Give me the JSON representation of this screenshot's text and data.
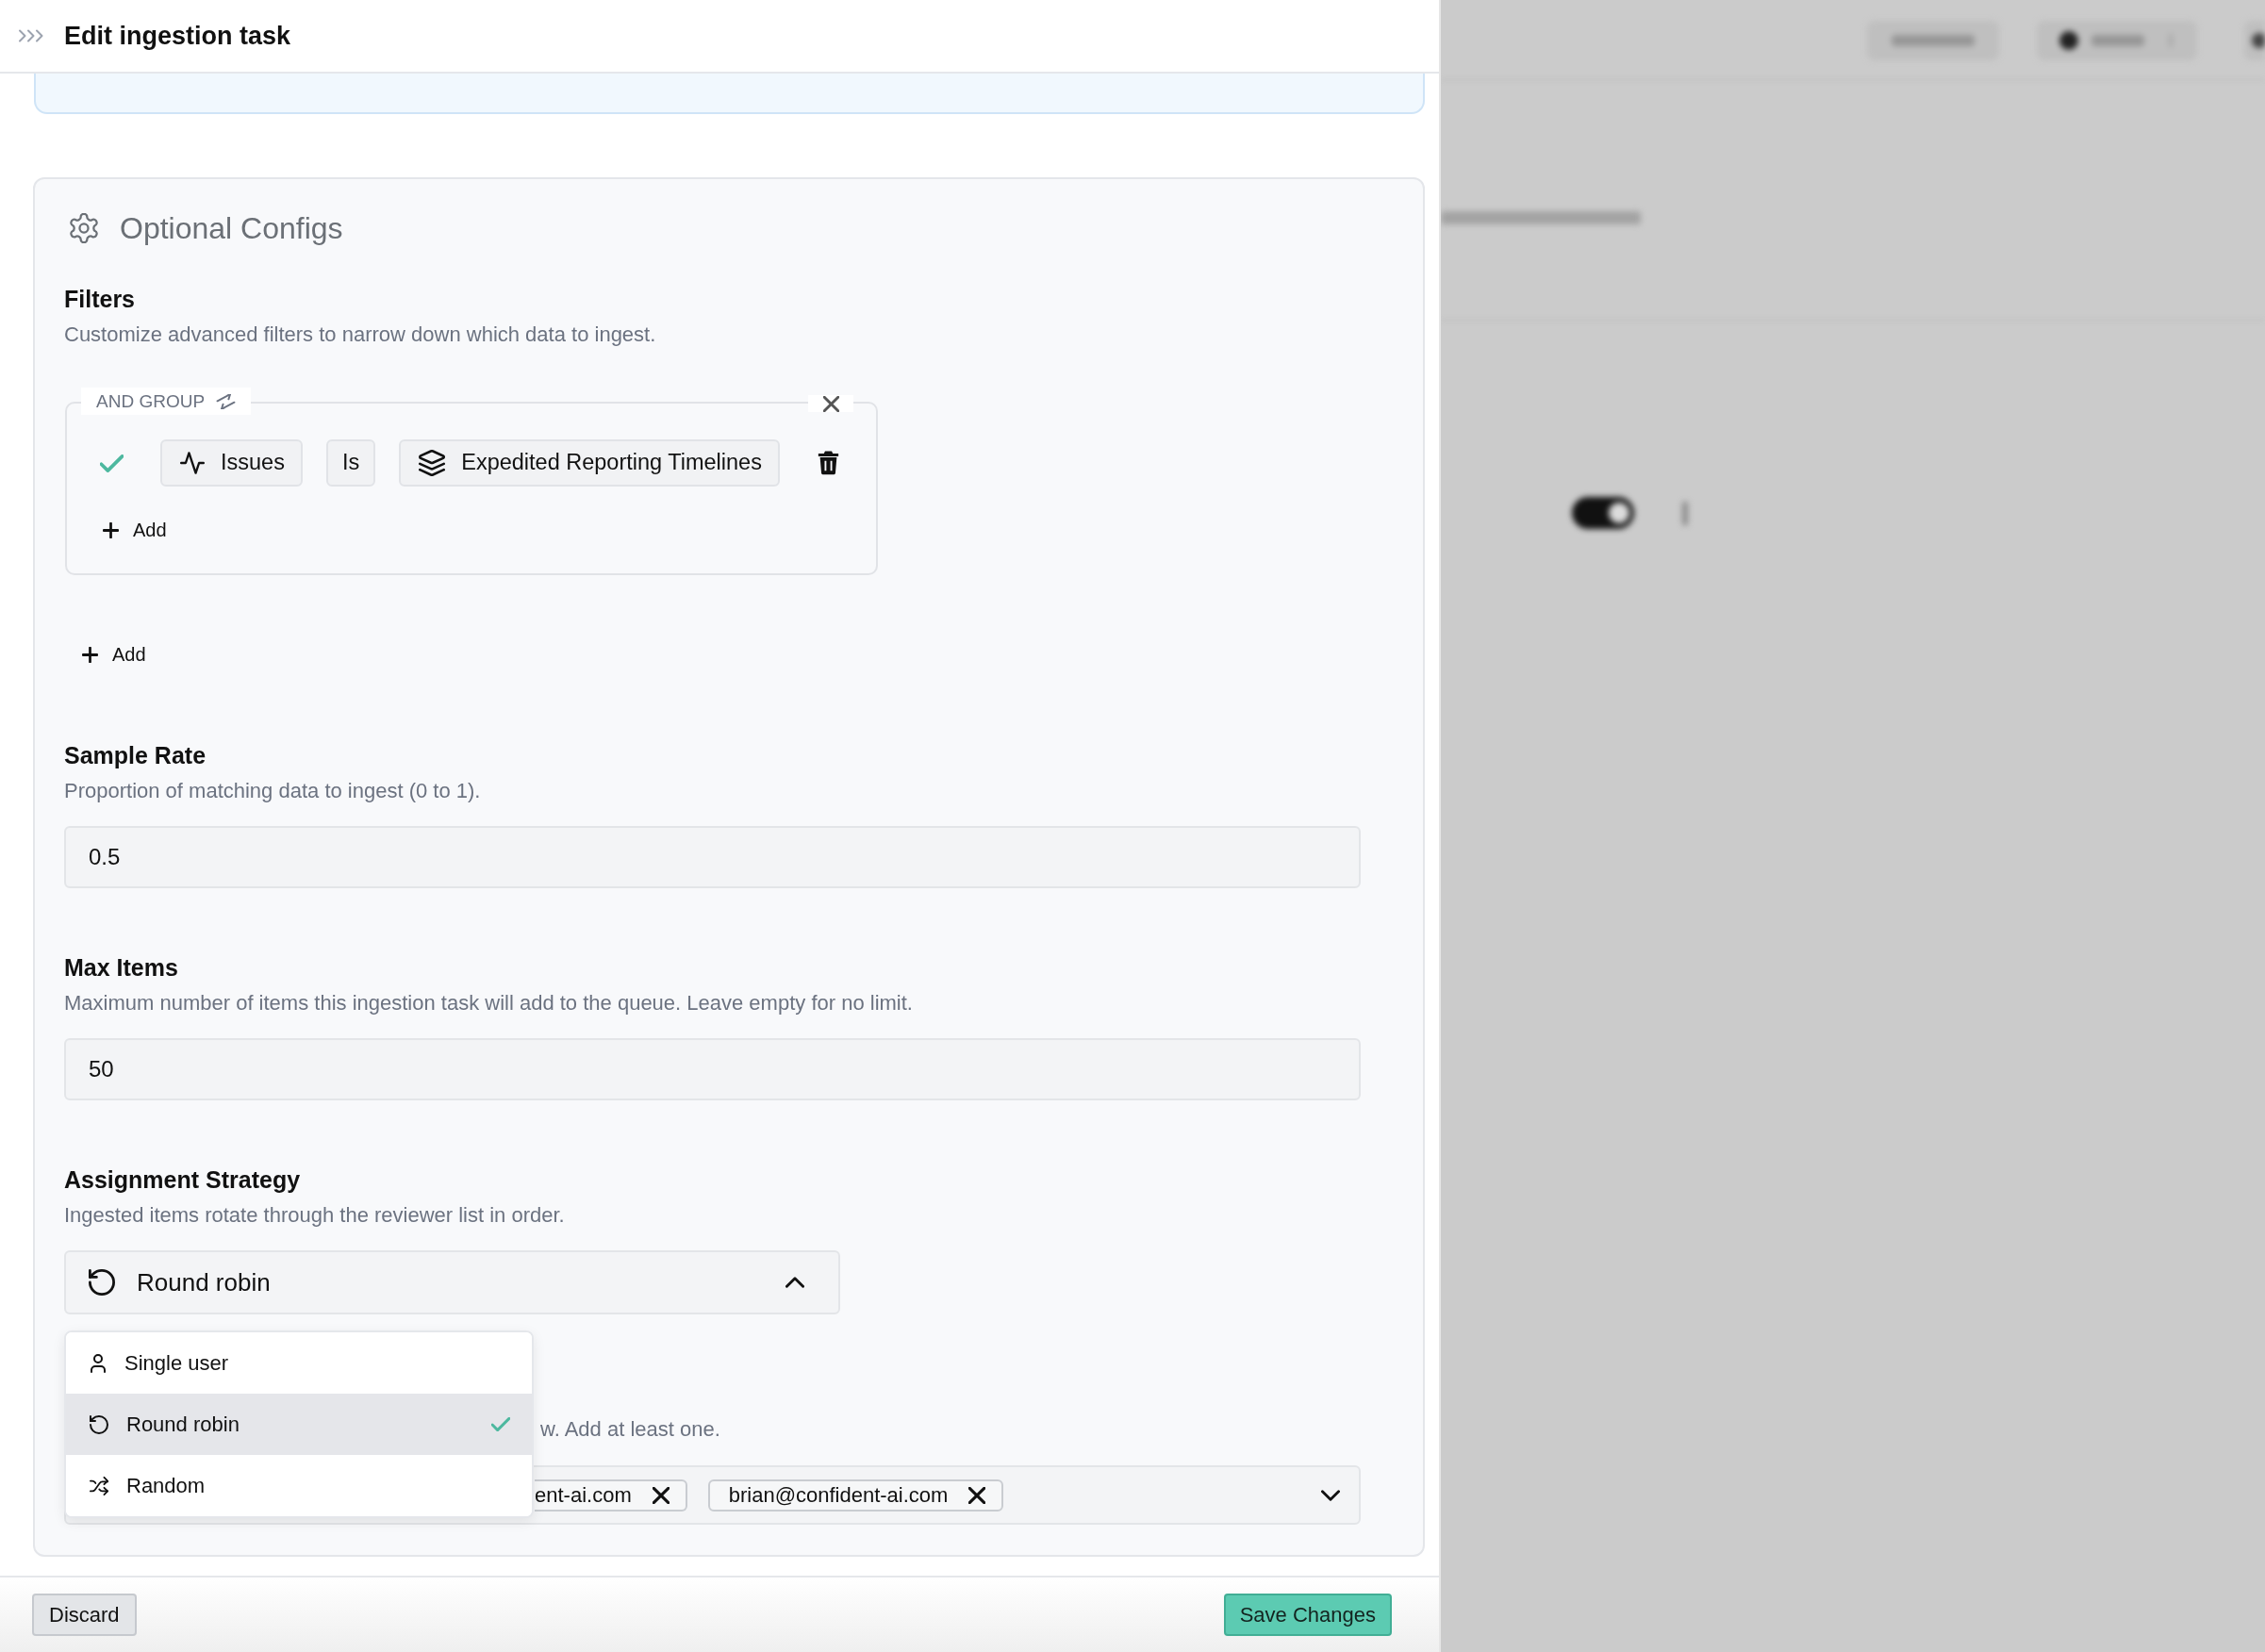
{
  "drawer": {
    "title": "Edit ingestion task"
  },
  "optional_configs": {
    "title": "Optional Configs",
    "filters": {
      "label": "Filters",
      "description": "Customize advanced filters to narrow down which data to ingest.",
      "groups": [
        {
          "operator": "AND GROUP",
          "conditions": [
            {
              "valid": true,
              "field": "Issues",
              "operator": "Is",
              "value": "Expedited Reporting Timelines"
            }
          ],
          "add_label": "Add"
        }
      ],
      "add_label": "Add"
    },
    "fields": [
      {
        "label": "Sample Rate",
        "description": "Proportion of matching data to ingest (0 to 1).",
        "value": "0.5"
      },
      {
        "label": "Max Items",
        "description": "Maximum number of items this ingestion task will add to the queue. Leave empty for no limit.",
        "value": "50"
      }
    ],
    "assignment_strategy": {
      "label": "Assignment Strategy",
      "description": "Ingested items rotate through the reviewer list in order.",
      "value": "Round robin",
      "expanded": true,
      "options": [
        {
          "label": "Single user",
          "kind": "user",
          "selected": false
        },
        {
          "label": "Round robin",
          "kind": "round-robin",
          "selected": true
        },
        {
          "label": "Random",
          "kind": "random",
          "selected": false
        }
      ]
    },
    "reviewers": {
      "description": "w. Add at least one.",
      "chips": [
        "ent-ai.com",
        "brian@confident-ai.com"
      ]
    }
  },
  "footer": {
    "buttons": [
      {
        "label": "Discard",
        "kind": "secondary"
      },
      {
        "label": "Save Changes",
        "kind": "primary"
      }
    ]
  }
}
